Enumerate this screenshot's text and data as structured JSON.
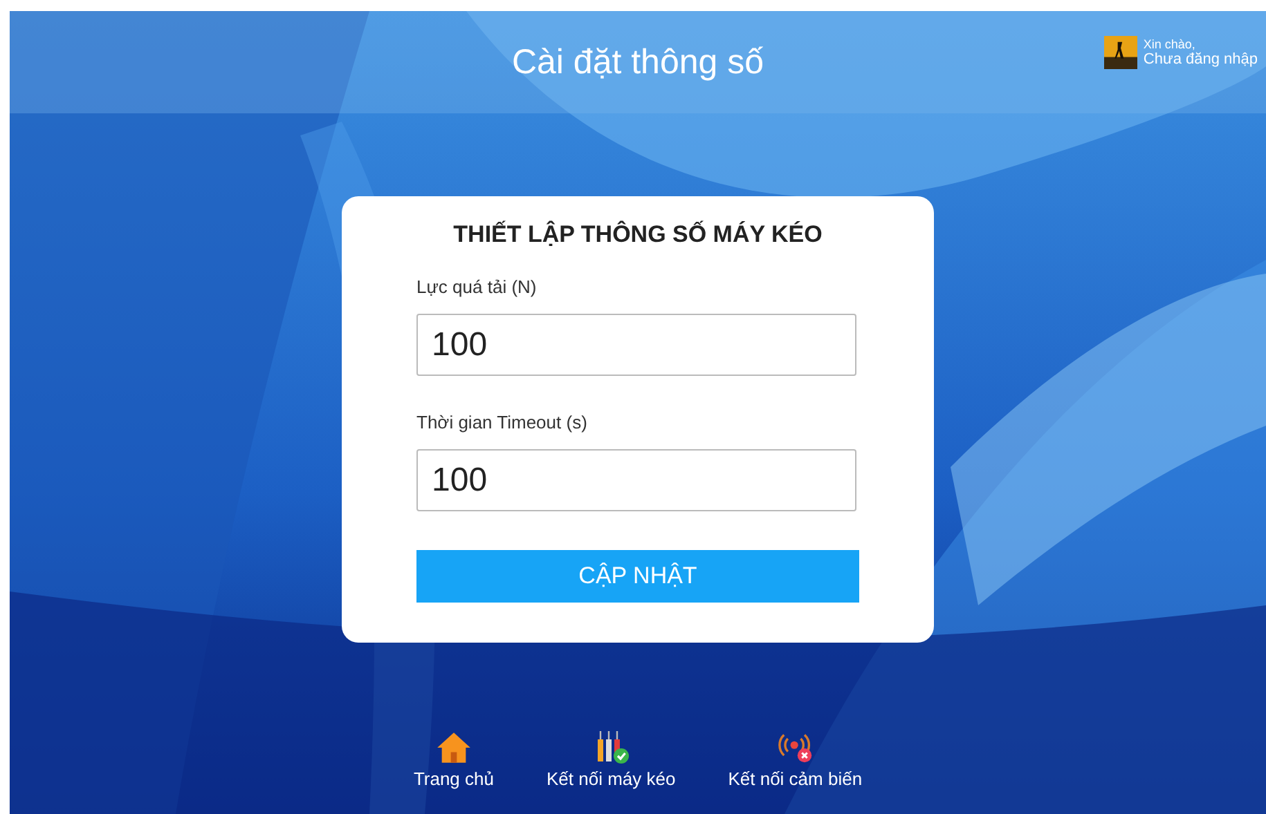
{
  "header": {
    "title": "Cài đặt thông số",
    "user": {
      "greeting": "Xin chào,",
      "status": "Chưa đăng nhập"
    }
  },
  "form": {
    "title": "THIẾT LẬP THÔNG SỐ MÁY KÉO",
    "fields": [
      {
        "label": "Lực quá tải (N)",
        "value": "100"
      },
      {
        "label": "Thời gian Timeout (s)",
        "value": "100"
      }
    ],
    "submit": "CẬP NHẬT"
  },
  "nav": [
    {
      "kind": "home",
      "label": "Trang chủ"
    },
    {
      "kind": "machine",
      "label": "Kết nối máy kéo",
      "connected": true
    },
    {
      "kind": "sensor",
      "label": "Kết nối cảm biến",
      "connected": false
    }
  ]
}
